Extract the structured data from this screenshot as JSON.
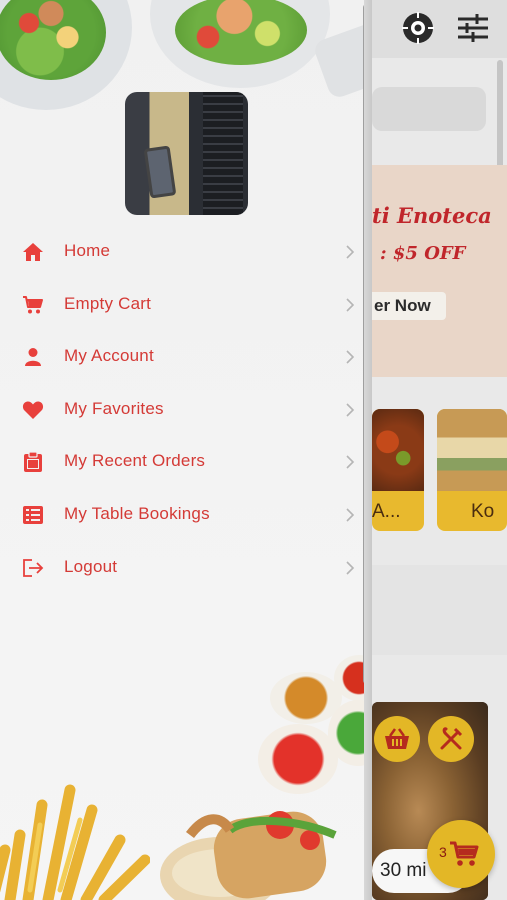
{
  "drawer": {
    "menu": [
      {
        "label": "Home",
        "icon": "home-icon"
      },
      {
        "label": "Empty Cart",
        "icon": "cart-icon"
      },
      {
        "label": "My Account",
        "icon": "user-icon"
      },
      {
        "label": "My Favorites",
        "icon": "heart-icon"
      },
      {
        "label": "My Recent Orders",
        "icon": "clipboard-icon"
      },
      {
        "label": "My Table Bookings",
        "icon": "list-icon"
      },
      {
        "label": "Logout",
        "icon": "logout-icon"
      }
    ]
  },
  "background": {
    "banner": {
      "title": "ti Enoteca",
      "offer": ": $5 OFF",
      "button": "er Now"
    },
    "restaurants": [
      {
        "name": "A..."
      },
      {
        "name": "Ko"
      }
    ],
    "food_card": {
      "time": "30 mi"
    },
    "cart": {
      "count": "3"
    }
  },
  "colors": {
    "accent_red": "#d43a36",
    "gold": "#e3b726",
    "drawer_bg": "#f1f1f1"
  }
}
